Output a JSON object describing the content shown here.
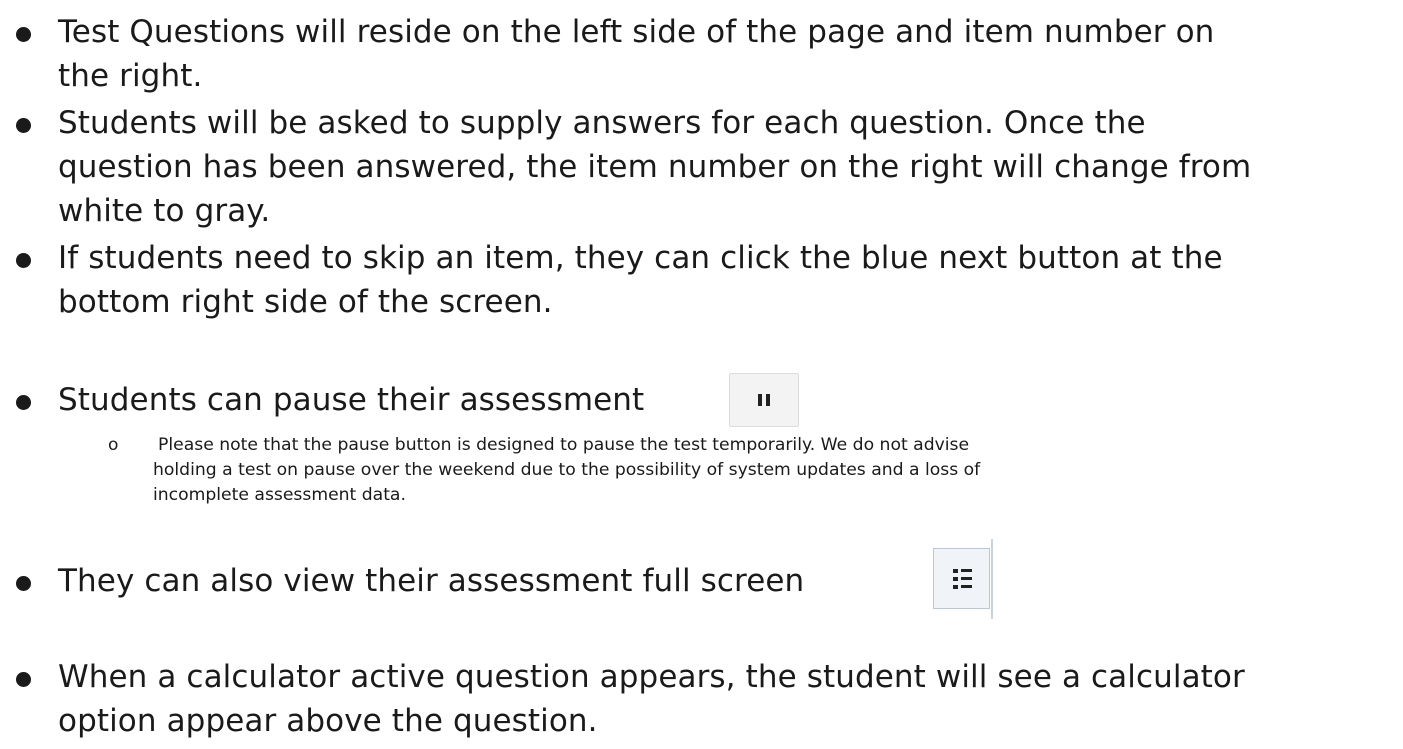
{
  "bullets": [
    {
      "lines": [
        "Test Questions will reside on the left side of the page and item number on",
        "the right."
      ]
    },
    {
      "lines": [
        "Students will be asked to supply answers for each question.  Once the",
        "question has been answered, the item number on the right will change from",
        "white to gray."
      ]
    },
    {
      "lines": [
        "If students need to skip an item, they can click the blue next button at the",
        "bottom right side of the screen."
      ]
    },
    {
      "lines": [
        "Students can pause their assessment"
      ]
    },
    {
      "lines": [
        "They can also view their assessment full screen"
      ]
    },
    {
      "lines": [
        "When a calculator active question appears, the student will see a calculator",
        "option appear above the question."
      ]
    }
  ],
  "sub_bullet": {
    "marker": "o",
    "lines": [
      "Please note that the pause button is designed to pause the test temporarily.  We do not advise",
      "holding a test on pause over the weekend due to the possibility of system updates and a loss of",
      "incomplete assessment data."
    ]
  },
  "icons": {
    "pause": "pause-icon",
    "fullscreen": "list-icon"
  }
}
